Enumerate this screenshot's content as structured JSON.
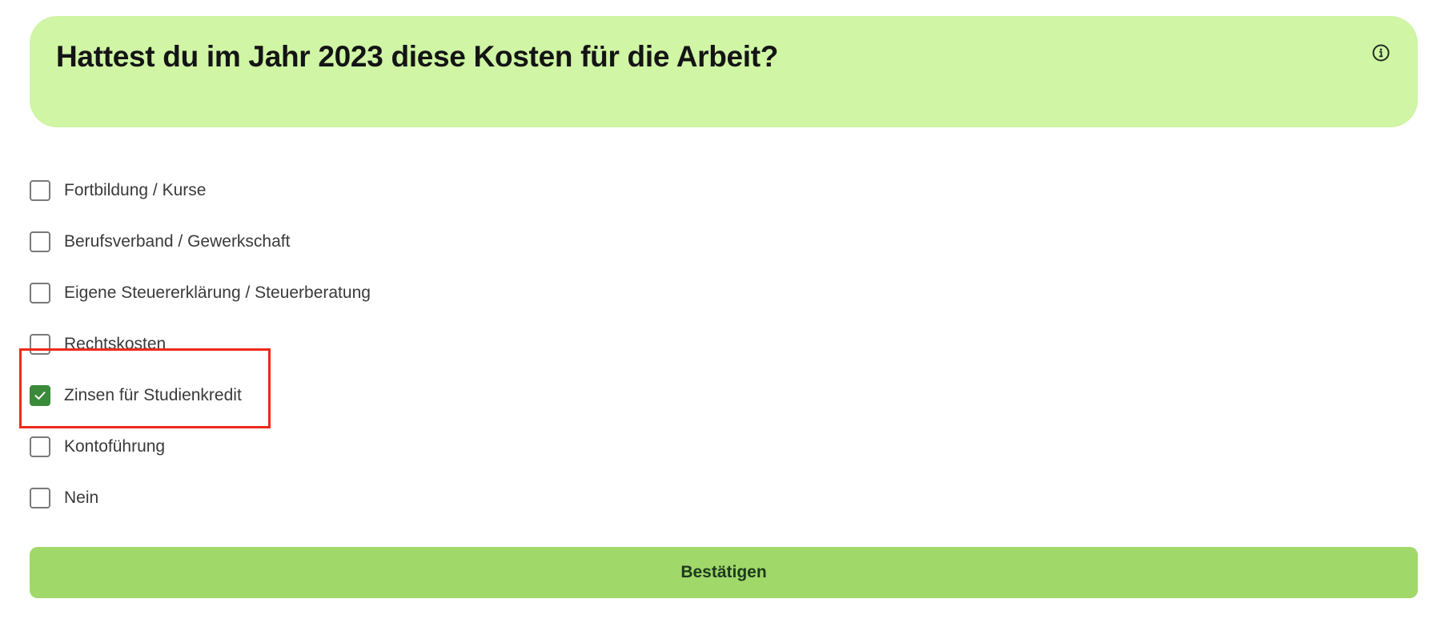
{
  "question": {
    "title": "Hattest du im Jahr 2023 diese Kosten für die Arbeit?",
    "info_icon": "info-circle-icon"
  },
  "options": [
    {
      "label": "Fortbildung / Kurse",
      "checked": false
    },
    {
      "label": "Berufsverband / Gewerkschaft",
      "checked": false
    },
    {
      "label": "Eigene Steuererklärung / Steuerberatung",
      "checked": false
    },
    {
      "label": "Rechtskosten",
      "checked": false
    },
    {
      "label": "Zinsen für Studienkredit",
      "checked": true
    },
    {
      "label": "Kontoführung",
      "checked": false
    },
    {
      "label": "Nein",
      "checked": false
    }
  ],
  "confirm_button": {
    "label": "Bestätigen"
  },
  "colors": {
    "card_background": "#cff5a5",
    "button_background": "#a1d86a",
    "checkbox_checked": "#3a8a3a",
    "highlight": "#ee2a1b"
  }
}
